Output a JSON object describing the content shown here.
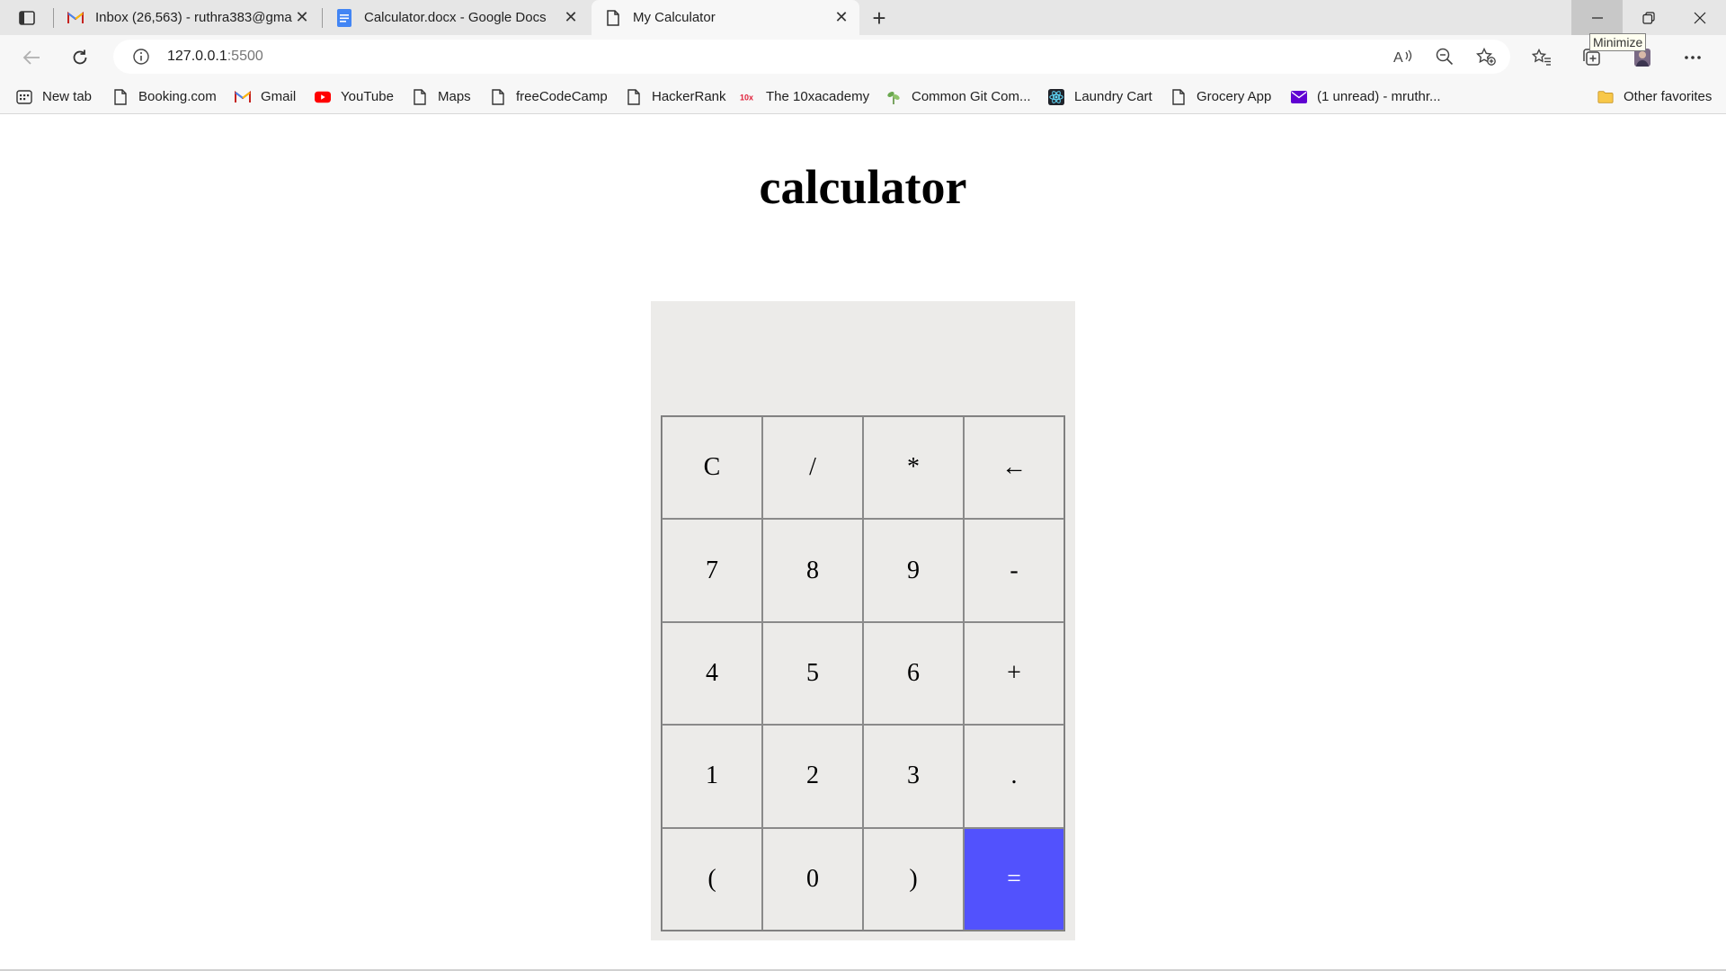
{
  "browser": {
    "tabs": [
      {
        "title": "Inbox (26,563) - ruthra383@gma",
        "favicon": "gmail-icon",
        "active": false
      },
      {
        "title": "Calculator.docx - Google Docs",
        "favicon": "google-docs-icon",
        "active": false
      },
      {
        "title": "My Calculator",
        "favicon": "page-icon",
        "active": true
      }
    ],
    "close_glyph": "✕",
    "new_tab_glyph": "+",
    "url_host": "127.0.0.1",
    "url_port": ":5500",
    "tooltip": "Minimize",
    "bookmarks": [
      {
        "label": "New tab",
        "icon": "new-tab-icon"
      },
      {
        "label": "Booking.com",
        "icon": "page-icon"
      },
      {
        "label": "Gmail",
        "icon": "gmail-icon"
      },
      {
        "label": "YouTube",
        "icon": "youtube-icon"
      },
      {
        "label": "Maps",
        "icon": "page-icon"
      },
      {
        "label": "freeCodeCamp",
        "icon": "page-icon"
      },
      {
        "label": "HackerRank",
        "icon": "page-icon"
      },
      {
        "label": "The 10xacademy",
        "icon": "10x-icon"
      },
      {
        "label": "Common Git Com...",
        "icon": "plant-icon"
      },
      {
        "label": "Laundry Cart",
        "icon": "react-icon"
      },
      {
        "label": "Grocery App",
        "icon": "page-icon"
      },
      {
        "label": "(1 unread) - mruthr...",
        "icon": "mail-icon"
      }
    ],
    "other_favorites": "Other favorites",
    "colors": {
      "tab_strip": "#e6e6e6",
      "toolbar": "#f7f7f7",
      "youtube": "#ff0000",
      "yahoo_mail": "#6001d2",
      "folder": "#f8c849"
    }
  },
  "page": {
    "title": "calculator",
    "display_value": "",
    "keys": [
      "C",
      "/",
      "*",
      "←",
      "7",
      "8",
      "9",
      "-",
      "4",
      "5",
      "6",
      "+",
      "1",
      "2",
      "3",
      ".",
      "(",
      "0",
      ")",
      "="
    ],
    "colors": {
      "calc_bg": "#ecebe9",
      "equals_bg": "#5252fd"
    }
  }
}
